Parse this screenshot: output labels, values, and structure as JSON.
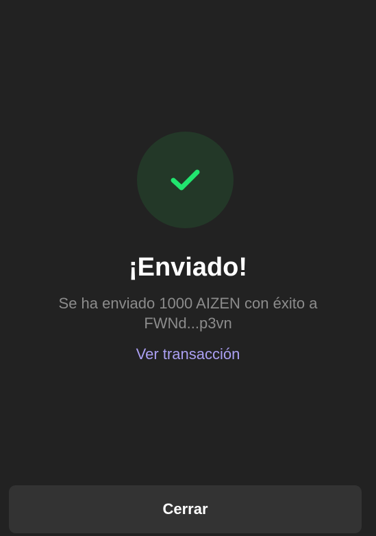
{
  "status": {
    "icon": "checkmark-icon",
    "circle_color": "#233828",
    "check_color": "#21e56f"
  },
  "title": "¡Enviado!",
  "message": {
    "line1": "Se ha enviado 1000 AIZEN con éxito a",
    "line2": "FWNd...p3vn"
  },
  "link": {
    "label": "Ver transacción",
    "color": "#ab9ff2"
  },
  "footer": {
    "close_label": "Cerrar"
  }
}
